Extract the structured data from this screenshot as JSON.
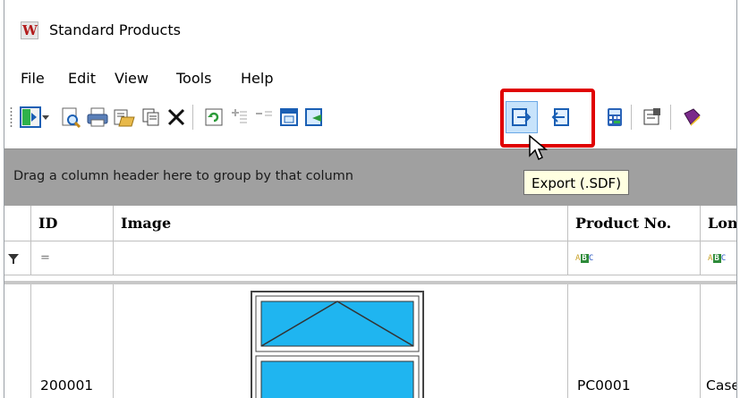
{
  "window": {
    "title": "Standard Products",
    "logo_letter": "W"
  },
  "menu": [
    "File",
    "Edit",
    "View",
    "Tools",
    "Help"
  ],
  "toolbar": {
    "buttons": [
      "layout-icon",
      "dropdown-arrow-icon",
      "print-preview-icon",
      "print-icon",
      "open-folder-icon",
      "copy-icon",
      "delete-icon",
      "refresh-icon",
      "insert-row-icon",
      "remove-row-icon",
      "properties-grid-icon",
      "import-icon",
      "export-sdf-icon",
      "import-sdf-icon",
      "calculator-icon",
      "settings-icon",
      "book-icon"
    ]
  },
  "group_panel": {
    "text": "Drag a column header here to group by that column"
  },
  "tooltip": {
    "text": "Export (.SDF)"
  },
  "grid": {
    "columns": [
      "ID",
      "Image",
      "Product No.",
      "Lon"
    ],
    "filter_row": {
      "id_filter": "=",
      "product_no_filter": "ABC",
      "lon_filter": "ABC"
    },
    "rows": [
      {
        "id": "200001",
        "product_no": "PC0001",
        "lon": "Case"
      }
    ]
  },
  "colors": {
    "highlight": "#e00000",
    "window_blue": "#1fb5f0",
    "group_bar": "#a0a0a0",
    "tooltip_bg": "#ffffe1"
  }
}
